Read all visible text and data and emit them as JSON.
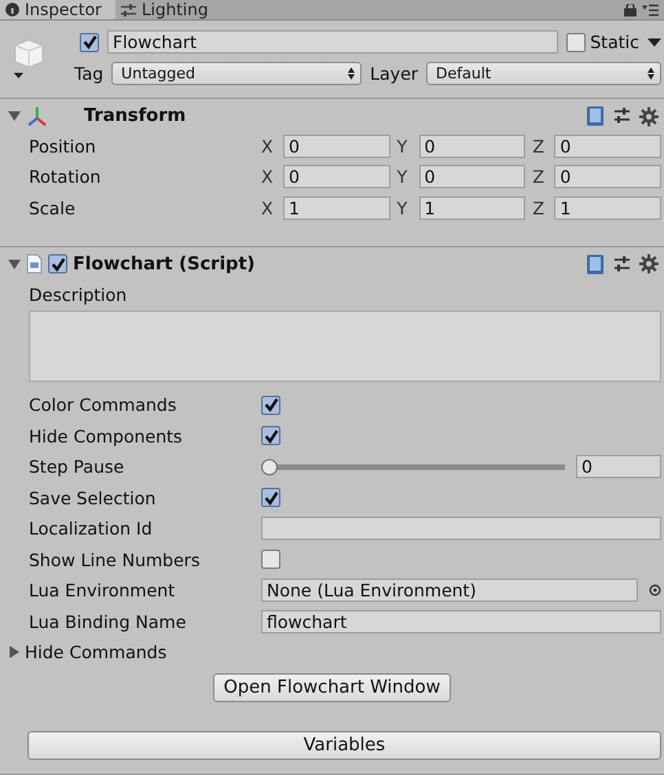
{
  "tabs": [
    {
      "label": "Inspector",
      "selected": true
    },
    {
      "label": "Lighting",
      "selected": false
    }
  ],
  "object": {
    "active": true,
    "name": "Flowchart",
    "static_label": "Static",
    "static": false,
    "tag_label": "Tag",
    "tag": "Untagged",
    "layer_label": "Layer",
    "layer": "Default"
  },
  "components": [
    {
      "kind": "transform",
      "title": "Transform",
      "expanded": true,
      "rows": [
        {
          "label": "Position",
          "values": [
            {
              "axis": "X",
              "value": "0"
            },
            {
              "axis": "Y",
              "value": "0"
            },
            {
              "axis": "Z",
              "value": "0"
            }
          ]
        },
        {
          "label": "Rotation",
          "values": [
            {
              "axis": "X",
              "value": "0"
            },
            {
              "axis": "Y",
              "value": "0"
            },
            {
              "axis": "Z",
              "value": "0"
            }
          ]
        },
        {
          "label": "Scale",
          "values": [
            {
              "axis": "X",
              "value": "1"
            },
            {
              "axis": "Y",
              "value": "1"
            },
            {
              "axis": "Z",
              "value": "1"
            }
          ]
        }
      ]
    },
    {
      "kind": "script",
      "title": "Flowchart (Script)",
      "enabled": true,
      "expanded": true,
      "description_label": "Description",
      "properties": [
        {
          "kind": "checkbox",
          "label": "Color Commands",
          "checked": true
        },
        {
          "kind": "checkbox",
          "label": "Hide Components",
          "checked": true
        },
        {
          "kind": "slider",
          "label": "Step Pause",
          "level": 0,
          "value": "0"
        },
        {
          "kind": "checkbox",
          "label": "Save Selection",
          "checked": true
        },
        {
          "kind": "text",
          "label": "Localization Id"
        },
        {
          "kind": "checkbox",
          "label": "Show Line Numbers",
          "checked": false
        },
        {
          "kind": "object",
          "label": "Lua Environment",
          "value": "None (Lua Environment)"
        },
        {
          "kind": "text",
          "label": "Lua Binding Name",
          "value": "flowchart"
        },
        {
          "kind": "foldout",
          "label": "Hide Commands",
          "expanded": false
        }
      ],
      "window_button": "Open Flowchart Window",
      "variables_button": "Variables"
    }
  ]
}
